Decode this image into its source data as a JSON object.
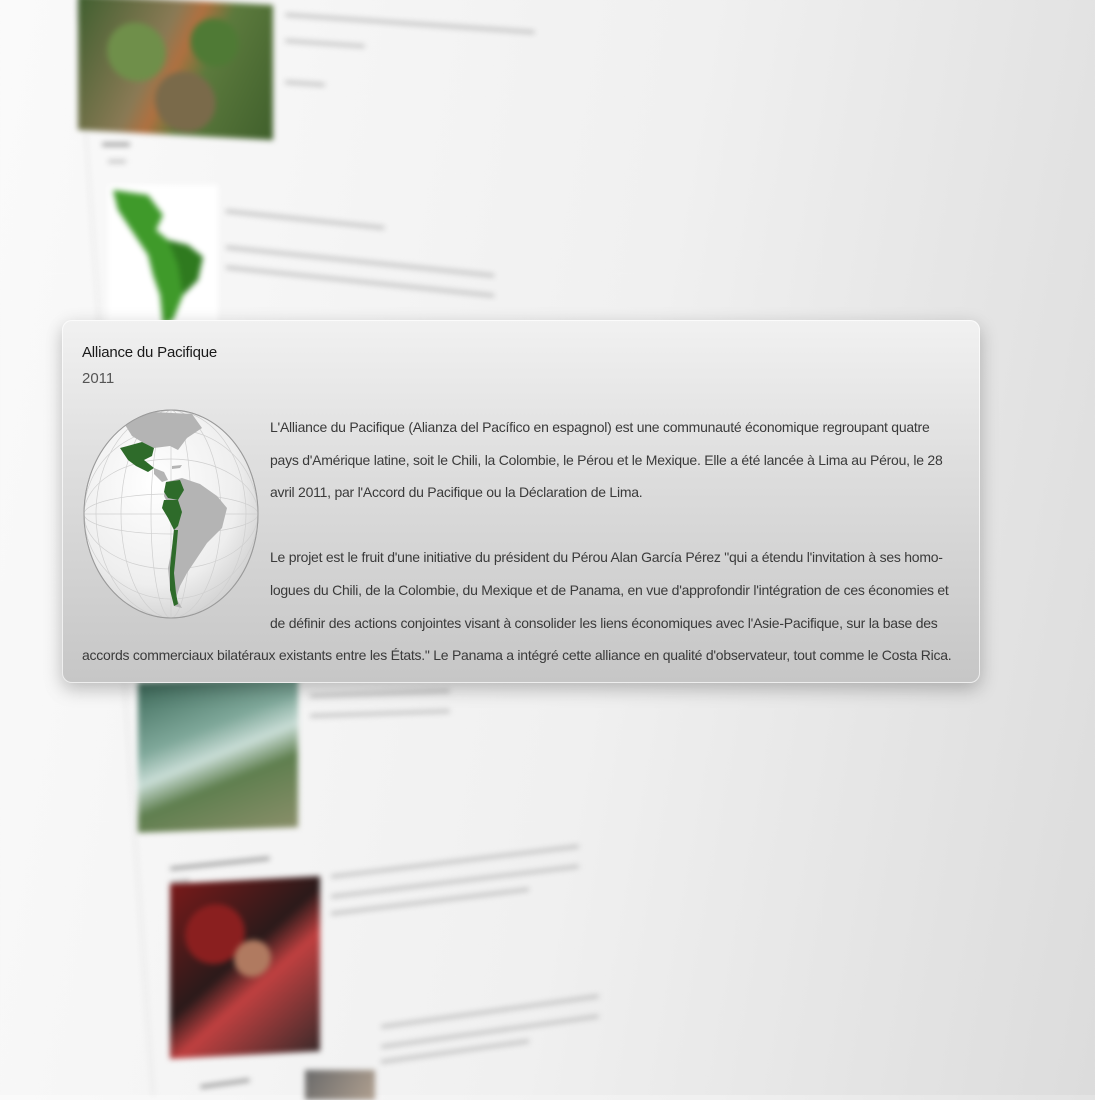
{
  "popup": {
    "title": "Alliance du Pacifique",
    "year": "2011",
    "paragraphs": [
      "L'Alliance du Pacifique (Alianza del Pacífico en espagnol) est une communauté économique regroupant quatre pays d'Amérique latine, soit le Chili, la Colombie, le Pérou et le Mexique. Elle a été lancée à Lima au Pérou, le 28 avril 2011, par l'Accord du Pacifique ou la Déclaration de Lima.",
      "Le projet est le fruit d'une initiative du président du Pérou Alan García Pérez \"qui a étendu l'invitation à ses homo-logues du Chili, de la Colombie, du Mexique et de Panama, en vue d'approfondir l'intégration de ces économies et de définir des actions conjointes visant à consolider les liens économiques avec l'Asie-Pacifique, sur la base des accords commerciaux bilatéraux existants entre les États.\" Le Panama a intégré cette alliance en qualité d'observateur, tout comme le Costa Rica."
    ],
    "map_icon": "globe-americas-map",
    "highlight_color": "#2e6b2a",
    "land_color": "#b4b4b4",
    "ocean_color": "#f4f4f4"
  },
  "background": {
    "accent_green": "#2f8a1f"
  }
}
